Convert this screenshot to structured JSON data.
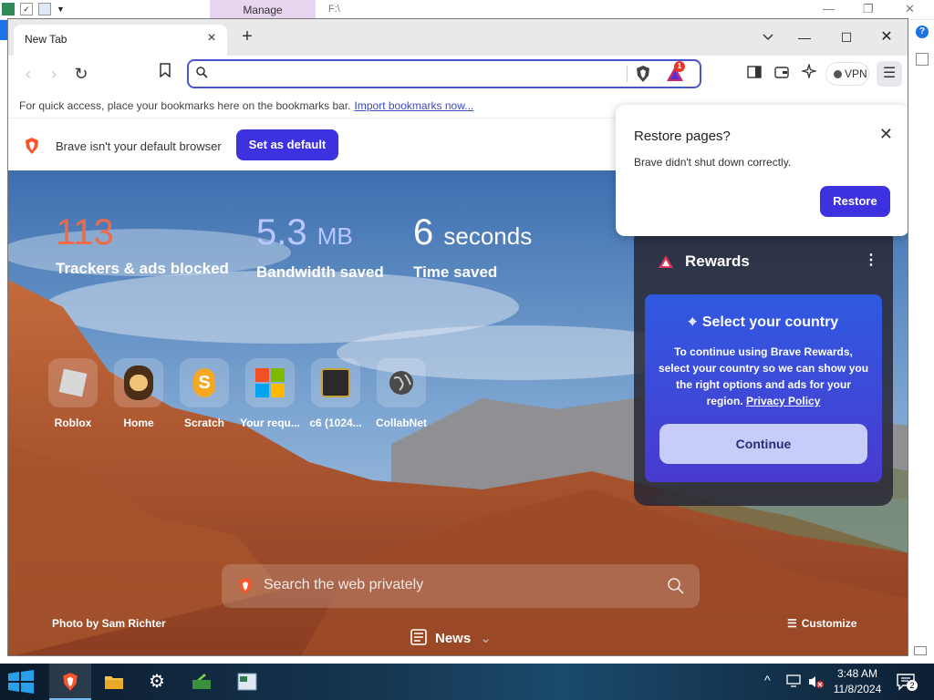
{
  "background_window": {
    "manage_tab": "Manage",
    "path_label": "F:\\",
    "help": "?"
  },
  "browser": {
    "tab": {
      "title": "New Tab",
      "close": "×"
    },
    "new_tab": "+",
    "tab_list": "⌄",
    "window_controls": {
      "minimize": "—",
      "maximize": "☐",
      "close": "✕"
    },
    "toolbar": {
      "back": "‹",
      "forward": "›",
      "reload": "↻",
      "bookmark": "☐",
      "omnibox_value": "",
      "rewards_badge": "1",
      "vpn_label": "VPN",
      "menu": "☰"
    },
    "bookmarks_bar": {
      "hint": "For quick access, place your bookmarks here on the bookmarks bar.",
      "import_link": "Import bookmarks now..."
    },
    "infobar": {
      "text": "Brave isn't your default browser",
      "button": "Set as default"
    }
  },
  "ntp": {
    "stats": [
      {
        "value": "113",
        "unit": "",
        "label": "Trackers & ads blocked"
      },
      {
        "value": "5.3",
        "unit": "MB",
        "label": "Bandwidth saved"
      },
      {
        "value": "6",
        "unit": "seconds",
        "label": "Time saved"
      }
    ],
    "top_sites": [
      {
        "label": "Roblox",
        "icon": "roblox-icon"
      },
      {
        "label": "Home",
        "icon": "home-cartoon-icon"
      },
      {
        "label": "Scratch",
        "icon": "scratch-icon"
      },
      {
        "label": "Your requ...",
        "icon": "microsoft-icon"
      },
      {
        "label": "c6 (1024...",
        "icon": "c6-icon"
      },
      {
        "label": "CollabNet",
        "icon": "globe-icon"
      }
    ],
    "search_placeholder": "Search the web privately",
    "photo_credit": "Photo by Sam Richter",
    "news_label": "News",
    "customize_label": "Customize"
  },
  "rewards_card": {
    "title": "Rewards",
    "more": "⋮",
    "country_title": "Select your country",
    "country_body": "To continue using Brave Rewards, select your country so we can show you the right options and ads for your region.",
    "privacy_link": "Privacy Policy",
    "continue_button": "Continue"
  },
  "restore_popup": {
    "title": "Restore pages?",
    "message": "Brave didn't shut down correctly.",
    "button": "Restore",
    "close": "✕"
  },
  "taskbar": {
    "time": "3:48 AM",
    "date": "11/8/2024",
    "notification_count": "2",
    "tray_chevron": "^"
  }
}
